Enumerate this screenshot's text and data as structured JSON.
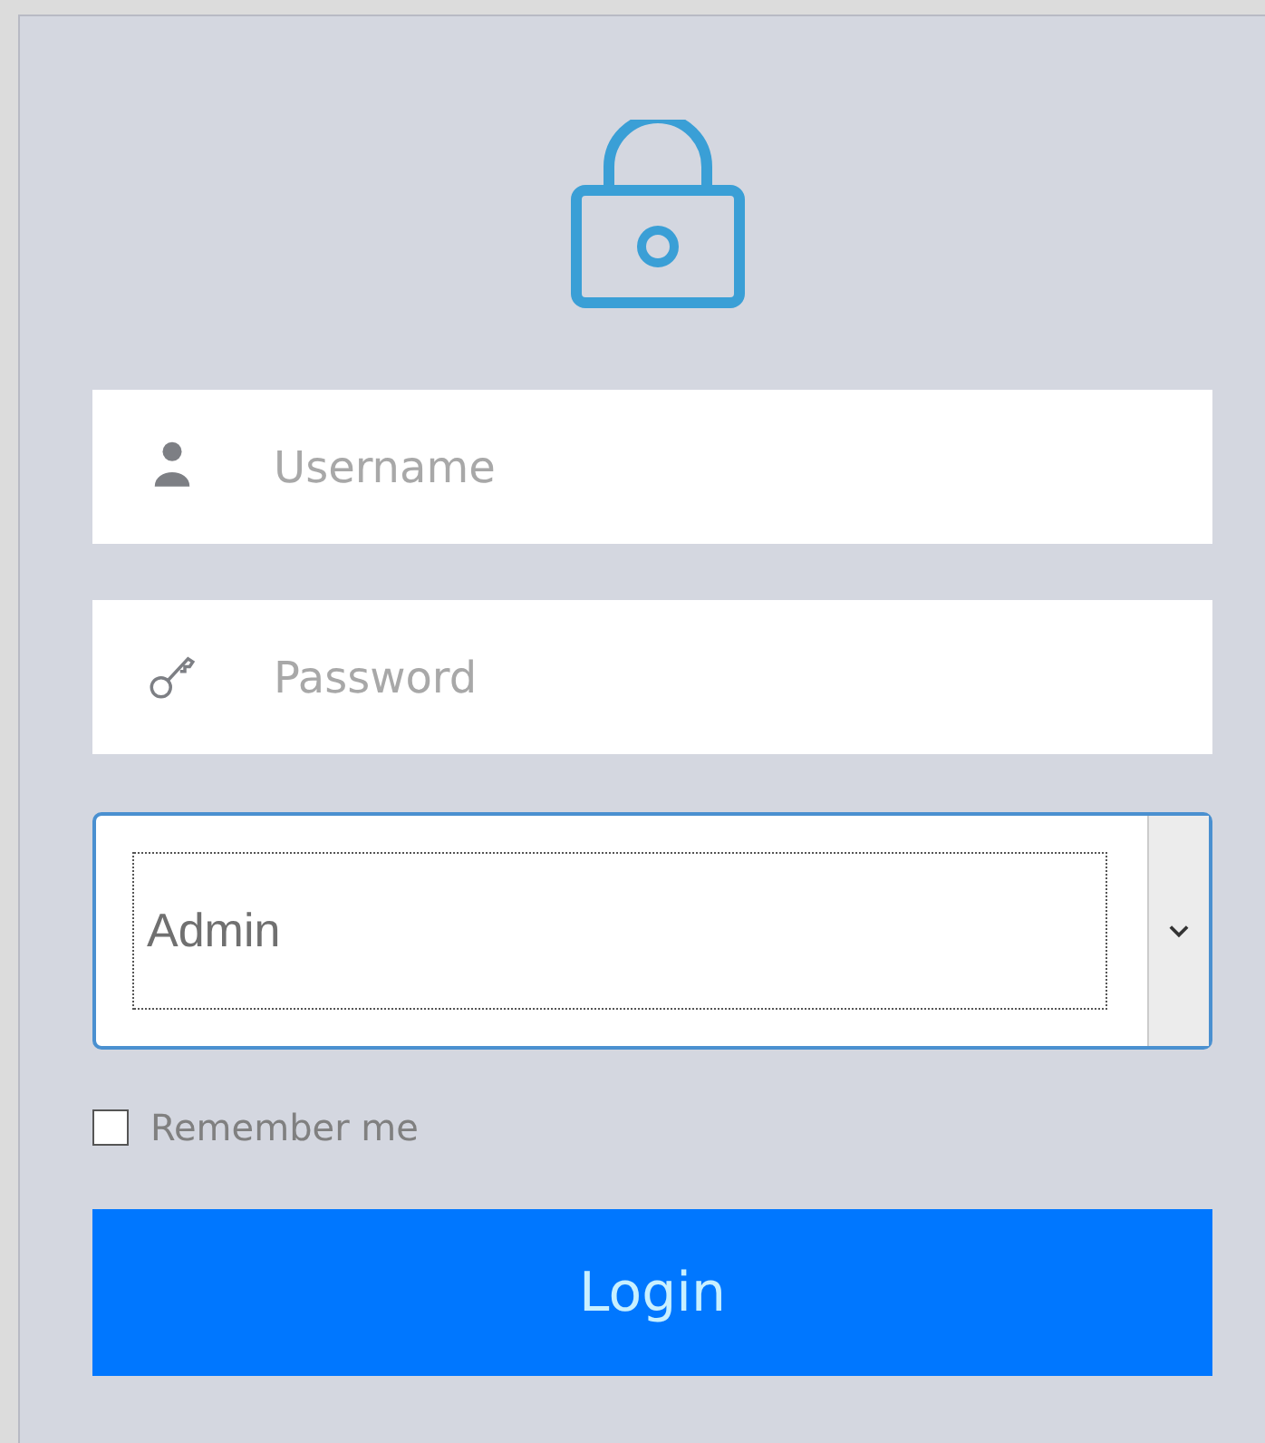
{
  "fields": [
    {
      "kind": "user",
      "placeholder": "Username"
    },
    {
      "kind": "key",
      "placeholder": "Password"
    }
  ],
  "role_select": {
    "value": "Admin"
  },
  "remember": {
    "label": "Remember me",
    "checked": false
  },
  "login_button": {
    "label": "Login"
  }
}
